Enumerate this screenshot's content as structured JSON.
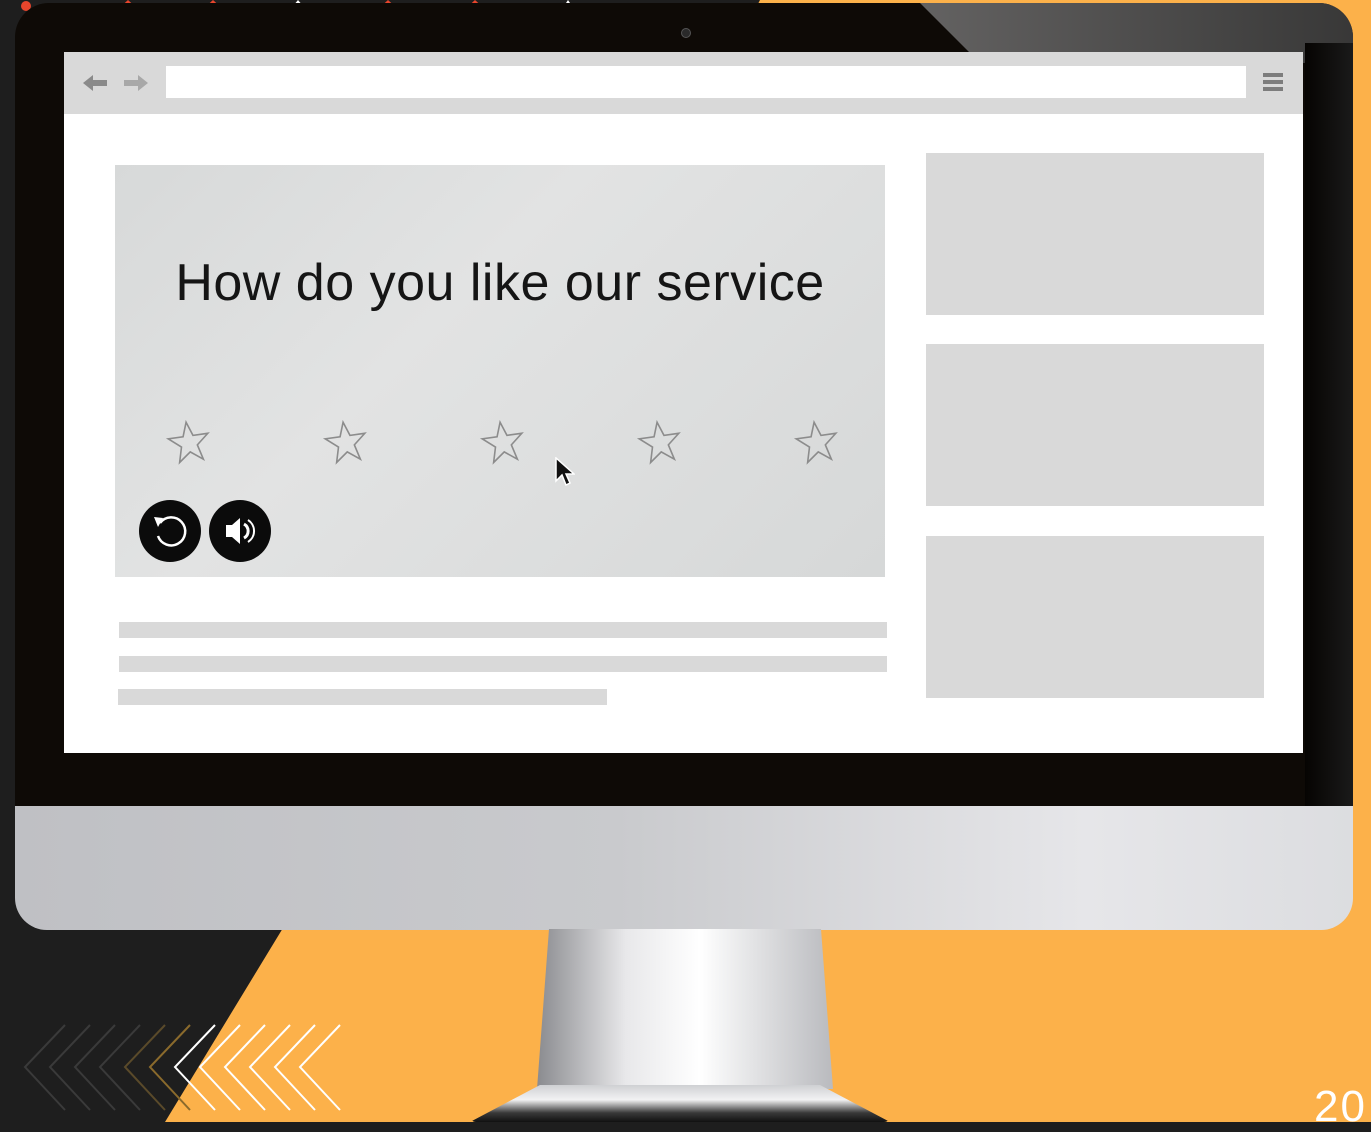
{
  "slide": {
    "page_number": "20",
    "colors": {
      "accent": "#fcb14a",
      "dark_background": "#1e1e1e",
      "deco_red": "#e8452c"
    }
  },
  "browser": {
    "back_icon": "arrow-left-icon",
    "forward_icon": "arrow-right-icon",
    "address_value": "",
    "menu_icon": "hamburger-menu-icon"
  },
  "video": {
    "question": "How do you like our service",
    "rating": {
      "max_stars": 5,
      "selected": 0
    },
    "controls": [
      {
        "icon": "replay-icon"
      },
      {
        "icon": "volume-icon"
      }
    ]
  },
  "placeholders": {
    "text_lines": 3,
    "side_boxes": 3
  }
}
